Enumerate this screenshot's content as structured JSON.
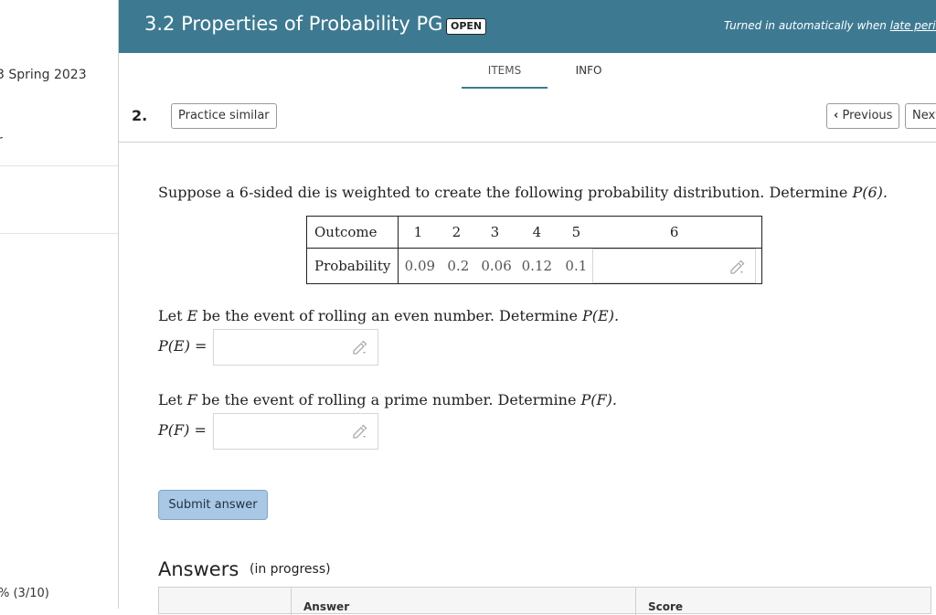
{
  "sidebar": {
    "course_fragment": "3 Spring 2023",
    "item_fragment": "r",
    "score_fragment": "% (3/10)"
  },
  "header": {
    "title": "3.2 Properties of Probability PG",
    "status_badge": "OPEN",
    "note_prefix": "Turned in automatically when ",
    "note_link": "late period e"
  },
  "tabs": [
    {
      "label": "ITEMS",
      "active": true
    },
    {
      "label": "INFO",
      "active": false
    }
  ],
  "question": {
    "number": "2.",
    "practice_label": "Practice similar",
    "previous_label": "Previous",
    "next_label": "Next",
    "prompt_before": "Suppose a 6-sided die is weighted to create the following probability distribution. Determine ",
    "prompt_math": "P(6).",
    "table": {
      "row1_label": "Outcome",
      "row2_label": "Probability",
      "outcomes": [
        "1",
        "2",
        "3",
        "4",
        "5",
        "6"
      ],
      "probabilities": [
        "0.09",
        "0.2",
        "0.06",
        "0.12",
        "0.1"
      ]
    },
    "part_e_before": "Let ",
    "part_e_var": "E",
    "part_e_after": " be the event of rolling an even number. Determine ",
    "part_e_math": "P(E).",
    "part_e_label": "P(E) =",
    "part_f_before": "Let ",
    "part_f_var": "F",
    "part_f_after": " be the event of rolling a prime number. Determine ",
    "part_f_math": "P(F).",
    "part_f_label": "P(F) =",
    "submit_label": "Submit answer"
  },
  "answers": {
    "title": "Answers",
    "status": "(in progress)",
    "col_answer": "Answer",
    "col_score": "Score"
  },
  "colors": {
    "header_bg": "#3d7a92",
    "submit_bg": "#a9c8e6"
  }
}
